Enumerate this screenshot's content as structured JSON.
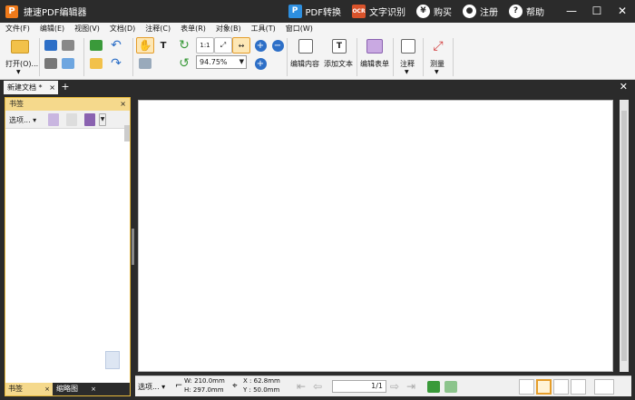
{
  "titlebar": {
    "logo": "P",
    "app_title": "捷速PDF编辑器",
    "actions": [
      {
        "label": "PDF转换",
        "icon": "pdf-convert-icon"
      },
      {
        "label": "文字识别",
        "icon": "ocr-icon"
      },
      {
        "label": "购买",
        "icon": "yen-icon"
      },
      {
        "label": "注册",
        "icon": "user-icon"
      },
      {
        "label": "帮助",
        "icon": "help-icon"
      }
    ],
    "window_buttons": [
      "—",
      "☐",
      "✕"
    ]
  },
  "menubar": [
    "文件(F)",
    "编辑(E)",
    "视图(V)",
    "文档(D)",
    "注释(C)",
    "表单(R)",
    "对象(B)",
    "工具(T)",
    "窗口(W)"
  ],
  "toolbar": {
    "open_label": "打开(O)...",
    "zoom_value": "94.75%",
    "edit_content_label": "编辑内容",
    "add_text_label": "添加文本",
    "edit_form_label": "编辑表单",
    "annotate_label": "注释",
    "measure_label": "测量",
    "colors": {
      "accent_green": "#3a9a3a",
      "accent_blue": "#2d6fc7",
      "accent_orange": "#e59d2a",
      "accent_red": "#d23a3a"
    }
  },
  "tabs": {
    "doc_tab_label": "新建文档 *",
    "close": "×",
    "add": "+"
  },
  "panel": {
    "title": "书签",
    "options_label": "选项...",
    "footer_tabs": [
      "书签",
      "缩略图"
    ]
  },
  "statusbar": {
    "options_label": "选项...",
    "width_label": "W:",
    "width_value": "210.0mm",
    "height_label": "H:",
    "height_value": "297.0mm",
    "x_label": "X :",
    "x_value": "62.8mm",
    "y_label": "Y :",
    "y_value": "50.0mm",
    "page_indicator": "1/1"
  }
}
